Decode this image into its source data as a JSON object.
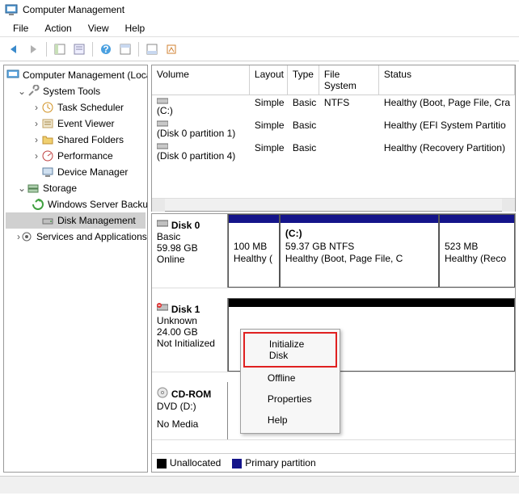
{
  "window": {
    "title": "Computer Management"
  },
  "menu": {
    "file": "File",
    "action": "Action",
    "view": "View",
    "help": "Help"
  },
  "tree": {
    "root": "Computer Management (Local)",
    "system_tools": "System Tools",
    "task_scheduler": "Task Scheduler",
    "event_viewer": "Event Viewer",
    "shared_folders": "Shared Folders",
    "performance": "Performance",
    "device_manager": "Device Manager",
    "storage": "Storage",
    "wsb": "Windows Server Backup",
    "disk_mgmt": "Disk Management",
    "services": "Services and Applications"
  },
  "vol_headers": {
    "volume": "Volume",
    "layout": "Layout",
    "type": "Type",
    "fs": "File System",
    "status": "Status"
  },
  "vol_rows": [
    {
      "volume": "(C:)",
      "layout": "Simple",
      "type": "Basic",
      "fs": "NTFS",
      "status": "Healthy (Boot, Page File, Cra"
    },
    {
      "volume": "(Disk 0 partition 1)",
      "layout": "Simple",
      "type": "Basic",
      "fs": "",
      "status": "Healthy (EFI System Partitio"
    },
    {
      "volume": "(Disk 0 partition 4)",
      "layout": "Simple",
      "type": "Basic",
      "fs": "",
      "status": "Healthy (Recovery Partition)"
    }
  ],
  "disk0": {
    "name": "Disk 0",
    "type": "Basic",
    "size": "59.98 GB",
    "status": "Online",
    "p1": {
      "size": "100 MB",
      "health": "Healthy ("
    },
    "p2": {
      "label": "(C:)",
      "size": "59.37 GB NTFS",
      "health": "Healthy (Boot, Page File, C"
    },
    "p3": {
      "size": "523 MB",
      "health": "Healthy (Reco"
    }
  },
  "disk1": {
    "name": "Disk 1",
    "type": "Unknown",
    "size": "24.00 GB",
    "status": "Not Initialized"
  },
  "cdrom": {
    "name": "CD-ROM",
    "type": "DVD (D:)",
    "status": "No Media"
  },
  "legend": {
    "unalloc": "Unallocated",
    "primary": "Primary partition"
  },
  "context": {
    "init": "Initialize Disk",
    "offline": "Offline",
    "properties": "Properties",
    "help": "Help"
  }
}
